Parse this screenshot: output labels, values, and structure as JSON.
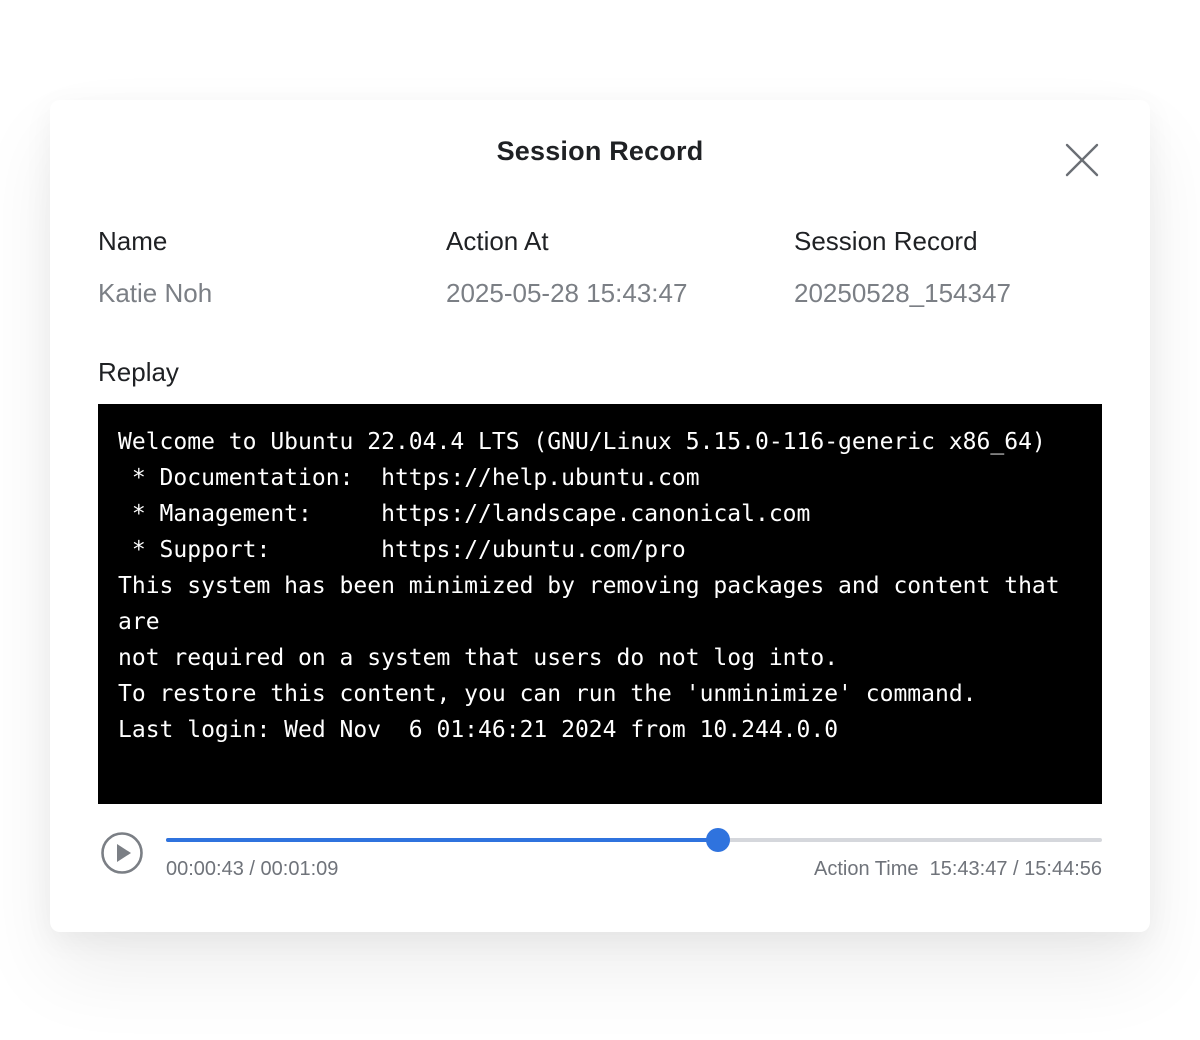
{
  "dialog": {
    "title": "Session Record",
    "close_icon": "close-icon"
  },
  "meta": {
    "name_label": "Name",
    "name_value": "Katie Noh",
    "action_at_label": "Action At",
    "action_at_value": "2025-05-28 15:43:47",
    "session_record_label": "Session Record",
    "session_record_value": "20250528_154347"
  },
  "replay": {
    "label": "Replay",
    "terminal_lines": [
      "Welcome to Ubuntu 22.04.4 LTS (GNU/Linux 5.15.0-116-generic x86_64)",
      " * Documentation:  https://help.ubuntu.com",
      " * Management:     https://landscape.canonical.com",
      " * Support:        https://ubuntu.com/pro",
      "This system has been minimized by removing packages and content that are",
      "not required on a system that users do not log into.",
      "To restore this content, you can run the 'unminimize' command.",
      "Last login: Wed Nov  6 01:46:21 2024 from 10.244.0.0"
    ]
  },
  "player": {
    "play_icon": "play-icon",
    "progress_percent": 59,
    "elapsed_time": "00:00:43 / 00:01:09",
    "action_time_label": "Action Time",
    "action_time_value": "15:43:47 / 15:44:56"
  },
  "colors": {
    "accent": "#2f73de",
    "terminal_bg": "#000000",
    "terminal_text": "#ffffff",
    "muted_text": "#7b7f85"
  }
}
